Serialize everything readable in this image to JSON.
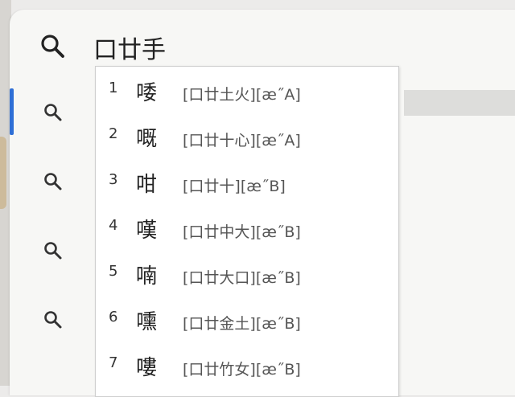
{
  "search": {
    "query": "口廿手",
    "placeholder": ""
  },
  "results": [
    {
      "icon": "search-icon"
    },
    {
      "icon": "search-icon",
      "selected": true
    },
    {
      "icon": "search-icon"
    },
    {
      "icon": "search-icon"
    },
    {
      "icon": "search-icon"
    }
  ],
  "ime": {
    "candidates": [
      {
        "index": "1",
        "char": "唩",
        "code": "[口廿土火][æ˝A]"
      },
      {
        "index": "2",
        "char": "嘅",
        "code": "[口廿十心][æ˝A]"
      },
      {
        "index": "3",
        "char": "咁",
        "code": "[口廿十][æ˝B]"
      },
      {
        "index": "4",
        "char": "嘆",
        "code": "[口廿中大][æ˝B]"
      },
      {
        "index": "5",
        "char": "喃",
        "code": "[口廿大口][æ˝B]"
      },
      {
        "index": "6",
        "char": "嚑",
        "code": "[口廿金土][æ˝B]"
      },
      {
        "index": "7",
        "char": "嘍",
        "code": "[口廿竹女][æ˝B]"
      }
    ]
  },
  "colors": {
    "accent": "#2f6fd6",
    "selected_row": "#dddddb",
    "background": "#f7f7f5"
  }
}
